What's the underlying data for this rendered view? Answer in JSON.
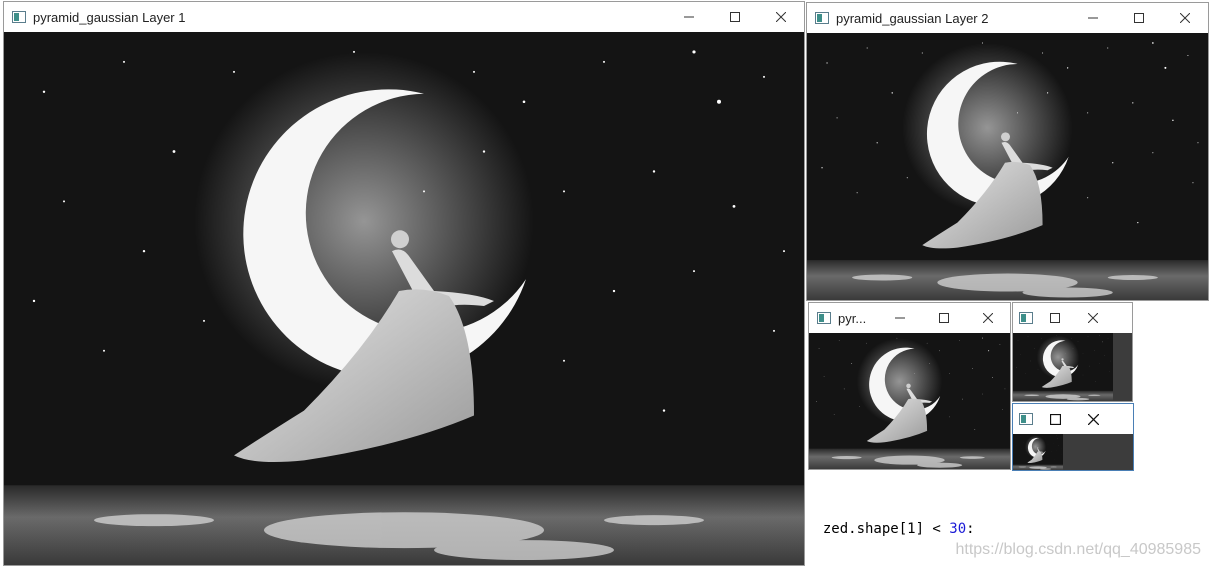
{
  "background_editor": {
    "code_line": "zed.shape[1] < 30:",
    "code_prefix": "zed.shape[1] < ",
    "code_number": "30",
    "code_suffix": ":",
    "watermark": "https://blog.csdn.net/qq_40985985"
  },
  "windows": [
    {
      "id": "layer1",
      "title": "pyramid_gaussian Layer 1"
    },
    {
      "id": "layer2",
      "title": "pyramid_gaussian Layer 2"
    },
    {
      "id": "layer3",
      "title": "pyr..."
    },
    {
      "id": "layer4",
      "title": ""
    },
    {
      "id": "layer5",
      "title": ""
    }
  ],
  "colors": {
    "titlebar": "#ffffff",
    "image_background": "#141414",
    "active_border": "#4a7fb5",
    "number_token": "#1a1ad6"
  },
  "icons": [
    "app-icon",
    "minimize-icon",
    "maximize-icon",
    "close-icon"
  ]
}
